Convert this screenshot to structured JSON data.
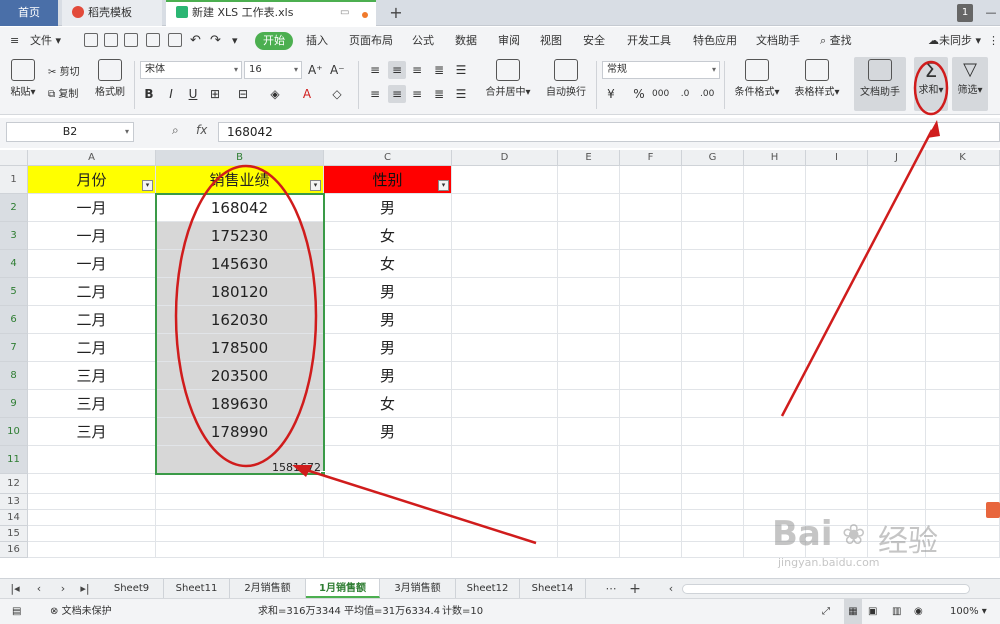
{
  "tabs": {
    "home": "首页",
    "docer": "稻壳模板",
    "workbook": "新建 XLS 工作表.xls",
    "window_badge": "1"
  },
  "menu": {
    "file": "文件",
    "start": "开始",
    "items": [
      "插入",
      "页面布局",
      "公式",
      "数据",
      "审阅",
      "视图",
      "安全",
      "开发工具",
      "特色应用",
      "文档助手"
    ],
    "search": "查找",
    "sync": "未同步"
  },
  "ribbon": {
    "paste": "粘贴",
    "cut": "剪切",
    "copy": "复制",
    "format_painter": "格式刷",
    "font_name": "宋体",
    "font_size": "16",
    "merge_center": "合并居中",
    "wrap_text": "自动换行",
    "number_format": "常规",
    "conditional_format": "条件格式",
    "table_style": "表格样式",
    "doc_assistant": "文档助手",
    "sum": "求和",
    "filter": "筛选"
  },
  "formula_bar": {
    "name_box": "B2",
    "fx": "fx",
    "value": "168042"
  },
  "sheet": {
    "columns": [
      "A",
      "B",
      "C",
      "D",
      "E",
      "F",
      "G",
      "H",
      "I",
      "J",
      "K"
    ],
    "header_row": {
      "a": "月份",
      "b": "销售业绩",
      "c": "性别"
    },
    "rows": [
      {
        "n": "1"
      },
      {
        "n": "2",
        "a": "一月",
        "b": "168042",
        "c": "男"
      },
      {
        "n": "3",
        "a": "一月",
        "b": "175230",
        "c": "女"
      },
      {
        "n": "4",
        "a": "一月",
        "b": "145630",
        "c": "女"
      },
      {
        "n": "5",
        "a": "二月",
        "b": "180120",
        "c": "男"
      },
      {
        "n": "6",
        "a": "二月",
        "b": "162030",
        "c": "男"
      },
      {
        "n": "7",
        "a": "二月",
        "b": "178500",
        "c": "男"
      },
      {
        "n": "8",
        "a": "三月",
        "b": "203500",
        "c": "男"
      },
      {
        "n": "9",
        "a": "三月",
        "b": "189630",
        "c": "女"
      },
      {
        "n": "10",
        "a": "三月",
        "b": "178990",
        "c": "男"
      },
      {
        "n": "11",
        "b": "1581672"
      },
      {
        "n": "12"
      },
      {
        "n": "13"
      },
      {
        "n": "14"
      },
      {
        "n": "15"
      },
      {
        "n": "16"
      }
    ]
  },
  "sheet_tabs": [
    "Sheet9",
    "Sheet11",
    "2月销售额",
    "1月销售额",
    "3月销售额",
    "Sheet12",
    "Sheet14"
  ],
  "active_sheet": "1月销售额",
  "status": {
    "protect": "文档未保护",
    "sum": "求和=316万3344",
    "avg": "平均值=31万6334.4",
    "count": "计数=10",
    "zoom": "100%"
  },
  "watermark": {
    "brand": "Bai",
    "brand2": "经验",
    "url": "jingyan.baidu.com"
  },
  "colors": {
    "accent": "#4caf50",
    "header_yellow": "#ffff00",
    "header_red": "#ff0000",
    "annotation_red": "#d01c1c"
  }
}
